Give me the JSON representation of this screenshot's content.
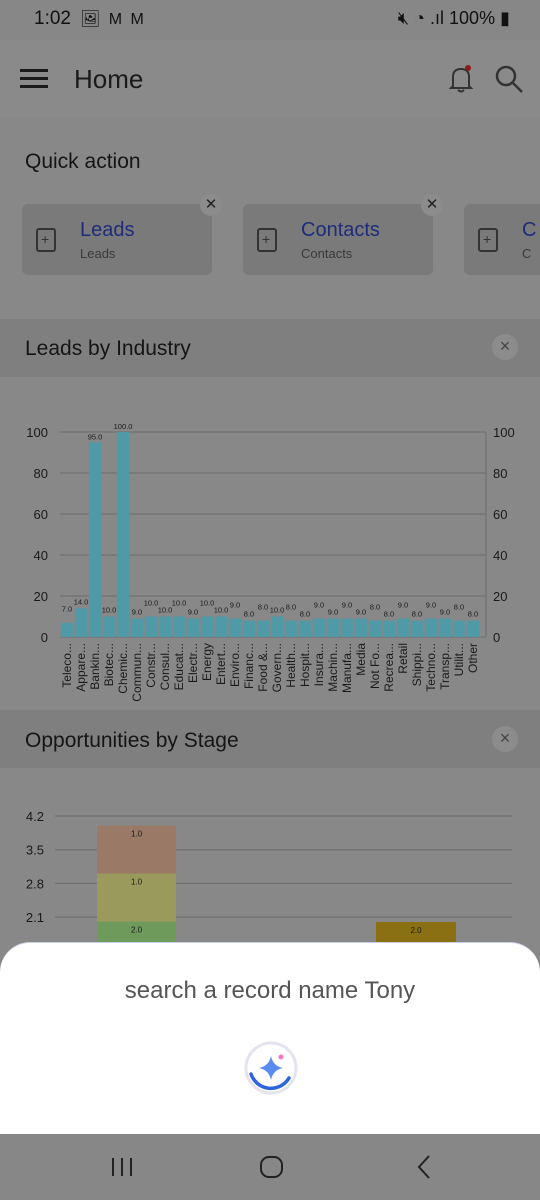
{
  "status": {
    "time": "1:02",
    "left_icons": "🖼 M M",
    "right": "100%"
  },
  "appbar": {
    "title": "Home"
  },
  "quick_action": {
    "title": "Quick action",
    "cards": [
      {
        "label": "Leads",
        "sub": "Leads"
      },
      {
        "label": "Contacts",
        "sub": "Contacts"
      },
      {
        "label": "C",
        "sub": "C"
      }
    ]
  },
  "leads_by_industry": {
    "title": "Leads by Industry",
    "close": "×"
  },
  "opportunities": {
    "title": "Opportunities by Stage",
    "close": "×"
  },
  "sheet": {
    "query": "search a record name Tony"
  },
  "chart_data": [
    {
      "type": "bar",
      "title": "Leads by Industry",
      "ylim": [
        0,
        100
      ],
      "yticks": [
        0,
        20,
        40,
        60,
        80,
        100
      ],
      "categories": [
        "Teleco...",
        "Appare...",
        "Bankin...",
        "Biotec...",
        "Chemic...",
        "Commun...",
        "Constr...",
        "Consul...",
        "Educat...",
        "Electr...",
        "Energy",
        "Entert...",
        "Enviro...",
        "Financ...",
        "Food &...",
        "Govern...",
        "Health...",
        "Hospit...",
        "Insura...",
        "Machin...",
        "Manufa...",
        "Media",
        "Not Fo...",
        "Recrea...",
        "Retail",
        "Shippi...",
        "Techno...",
        "Transp...",
        "Utilit...",
        "Other"
      ],
      "values": [
        7,
        14,
        95,
        10,
        100,
        9,
        10,
        10,
        10,
        9,
        10,
        10,
        9,
        8,
        8,
        10,
        8,
        8,
        9,
        9,
        9,
        9,
        8,
        8,
        9,
        8,
        9,
        9,
        8,
        8
      ],
      "bar_color": "#4f9aa6",
      "grid": true
    },
    {
      "type": "bar",
      "title": "Opportunities by Stage",
      "yticks": [
        2.1,
        2.8,
        3.5,
        4.2
      ],
      "stacks": [
        {
          "segments": [
            {
              "value": 1.0,
              "label": "1.0",
              "color": "#9a7a66"
            },
            {
              "value": 1.0,
              "label": "1.0",
              "color": "#9a9a5c"
            },
            {
              "value": 2.0,
              "label": "2.0",
              "color": "#6e9a5c"
            }
          ]
        },
        {
          "segments": [
            {
              "value": 2.0,
              "label": "2.0",
              "color": "#8a7012"
            }
          ]
        }
      ]
    }
  ]
}
